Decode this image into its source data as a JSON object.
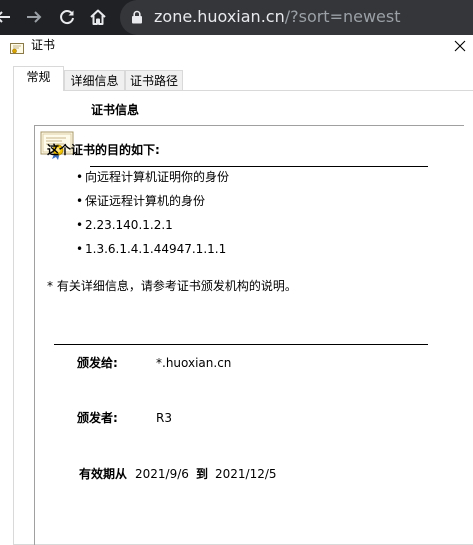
{
  "browser": {
    "url_host": "zone.huoxian.cn",
    "url_path": "/?sort=newest",
    "icons": [
      "back-arrow-icon",
      "forward-arrow-icon",
      "reload-icon",
      "home-icon",
      "lock-icon"
    ]
  },
  "dialog": {
    "title": "证书",
    "close_glyph": "✕",
    "tabs": [
      {
        "label": "常规",
        "active": true
      },
      {
        "label": "详细信息",
        "active": false
      },
      {
        "label": "证书路径",
        "active": false
      }
    ],
    "cert_info_title": "证书信息",
    "purpose_title": "这个证书的目的如下:",
    "purposes": [
      "向远程计算机证明你的身份",
      "保证远程计算机的身份",
      "2.23.140.1.2.1",
      "1.3.6.1.4.1.44947.1.1.1"
    ],
    "bullet": "•",
    "note": "* 有关详细信息，请参考证书颁发机构的说明。",
    "issued_to_label": "颁发给:",
    "issued_to_value": "*.huoxian.cn",
    "issued_by_label": "颁发者:",
    "issued_by_value": "R3",
    "valid_from_label": "有效期从",
    "valid_from_value": "2021/9/6",
    "valid_to_label": "到",
    "valid_to_value": "2021/12/5"
  },
  "colors": {
    "browser_bg": "#202124",
    "url_bg": "#35363a",
    "url_text": "#e8eaed",
    "url_path": "#9aa0a6"
  }
}
